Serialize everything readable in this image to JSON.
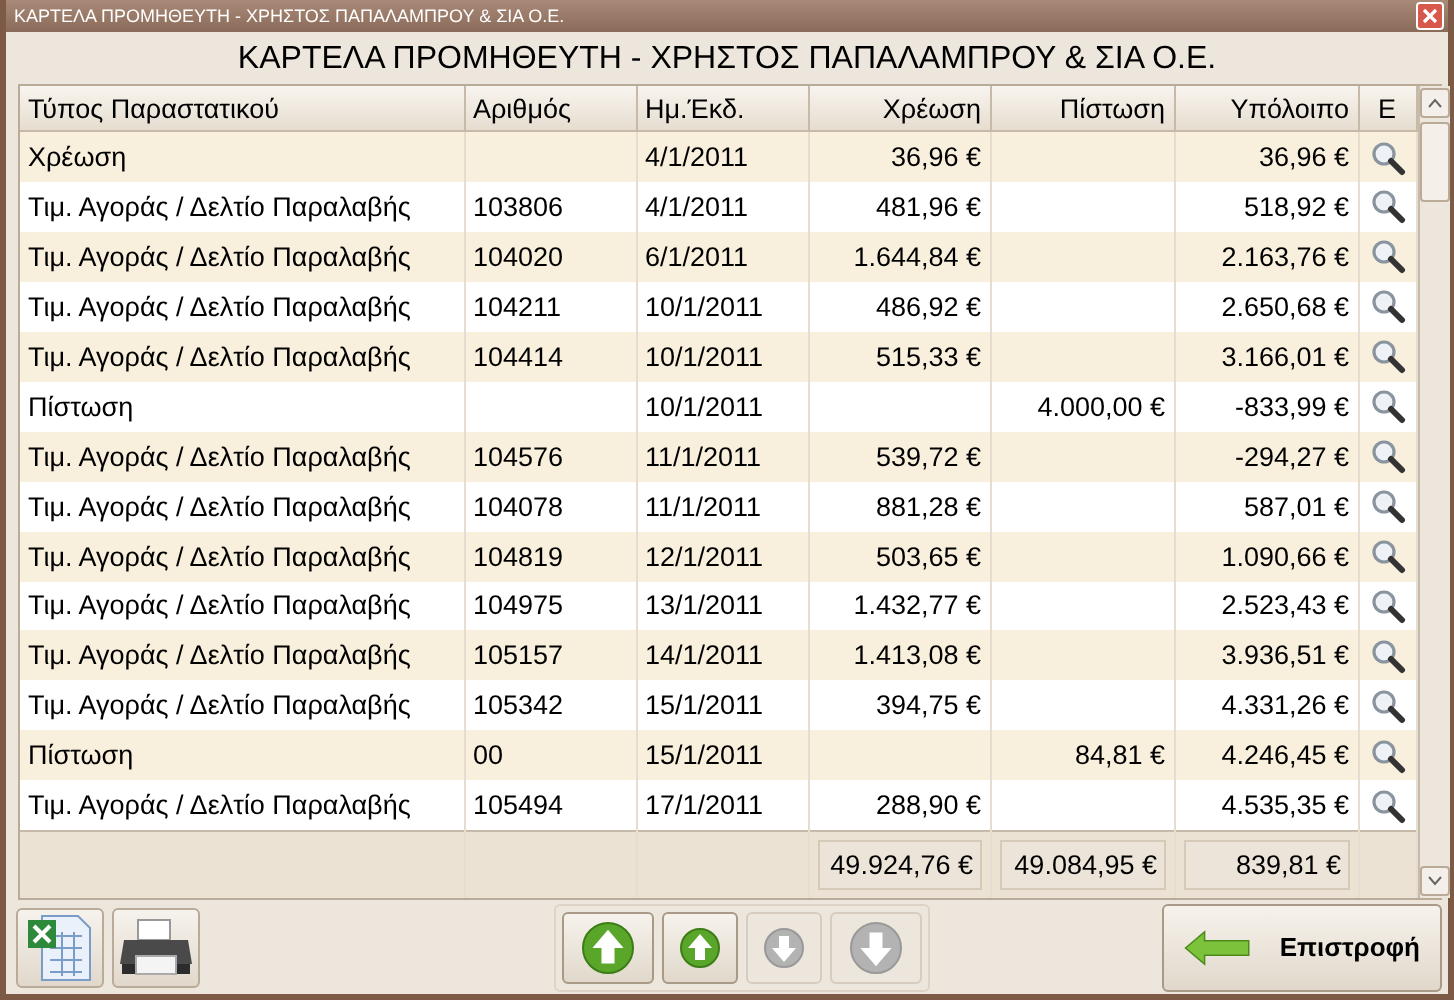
{
  "window": {
    "title": "ΚΑΡΤΕΛΑ ΠΡΟΜΗΘΕΥΤΗ - ΧΡΗΣΤΟΣ ΠΑΠΑΛΑΜΠΡΟΥ & ΣΙΑ Ο.Ε."
  },
  "heading": "ΚΑΡΤΕΛΑ ΠΡΟΜΗΘΕΥΤΗ - ΧΡΗΣΤΟΣ ΠΑΠΑΛΑΜΠΡΟΥ & ΣΙΑ Ο.Ε.",
  "table": {
    "columns": [
      "Τύπος Παραστατικού",
      "Αριθμός",
      "Ημ.Έκδ.",
      "Χρέωση",
      "Πίστωση",
      "Υπόλοιπο",
      "Ε"
    ],
    "rows": [
      {
        "type": "Χρέωση",
        "number": "",
        "date": "4/1/2011",
        "debit": "36,96 €",
        "credit": "",
        "balance": "36,96 €"
      },
      {
        "type": "Τιμ. Αγοράς / Δελτίο Παραλαβής",
        "number": "103806",
        "date": "4/1/2011",
        "debit": "481,96 €",
        "credit": "",
        "balance": "518,92 €"
      },
      {
        "type": "Τιμ. Αγοράς / Δελτίο Παραλαβής",
        "number": "104020",
        "date": "6/1/2011",
        "debit": "1.644,84 €",
        "credit": "",
        "balance": "2.163,76 €"
      },
      {
        "type": "Τιμ. Αγοράς / Δελτίο Παραλαβής",
        "number": "104211",
        "date": "10/1/2011",
        "debit": "486,92 €",
        "credit": "",
        "balance": "2.650,68 €"
      },
      {
        "type": "Τιμ. Αγοράς / Δελτίο Παραλαβής",
        "number": "104414",
        "date": "10/1/2011",
        "debit": "515,33 €",
        "credit": "",
        "balance": "3.166,01 €"
      },
      {
        "type": "Πίστωση",
        "number": "",
        "date": "10/1/2011",
        "debit": "",
        "credit": "4.000,00 €",
        "balance": "-833,99 €"
      },
      {
        "type": "Τιμ. Αγοράς / Δελτίο Παραλαβής",
        "number": "104576",
        "date": "11/1/2011",
        "debit": "539,72 €",
        "credit": "",
        "balance": "-294,27 €"
      },
      {
        "type": "Τιμ. Αγοράς / Δελτίο Παραλαβής",
        "number": "104078",
        "date": "11/1/2011",
        "debit": "881,28 €",
        "credit": "",
        "balance": "587,01 €"
      },
      {
        "type": "Τιμ. Αγοράς / Δελτίο Παραλαβής",
        "number": "104819",
        "date": "12/1/2011",
        "debit": "503,65 €",
        "credit": "",
        "balance": "1.090,66 €"
      },
      {
        "type": "Τιμ. Αγοράς / Δελτίο Παραλαβής",
        "number": "104975",
        "date": "13/1/2011",
        "debit": "1.432,77 €",
        "credit": "",
        "balance": "2.523,43 €"
      },
      {
        "type": "Τιμ. Αγοράς / Δελτίο Παραλαβής",
        "number": "105157",
        "date": "14/1/2011",
        "debit": "1.413,08 €",
        "credit": "",
        "balance": "3.936,51 €"
      },
      {
        "type": "Τιμ. Αγοράς / Δελτίο Παραλαβής",
        "number": "105342",
        "date": "15/1/2011",
        "debit": "394,75 €",
        "credit": "",
        "balance": "4.331,26 €"
      },
      {
        "type": "Πίστωση",
        "number": "00",
        "date": "15/1/2011",
        "debit": "",
        "credit": "84,81 €",
        "balance": "4.246,45 €"
      },
      {
        "type": "Τιμ. Αγοράς / Δελτίο Παραλαβής",
        "number": "105494",
        "date": "17/1/2011",
        "debit": "288,90 €",
        "credit": "",
        "balance": "4.535,35 €"
      }
    ],
    "totals": {
      "debit": "49.924,76 €",
      "credit": "49.084,95 €",
      "balance": "839,81 €"
    }
  },
  "nav_buttons": [
    {
      "kind": "first",
      "disabled": false
    },
    {
      "kind": "prev",
      "disabled": false
    },
    {
      "kind": "next",
      "disabled": true
    },
    {
      "kind": "last",
      "disabled": true
    }
  ],
  "back_button": "Επιστροφή"
}
